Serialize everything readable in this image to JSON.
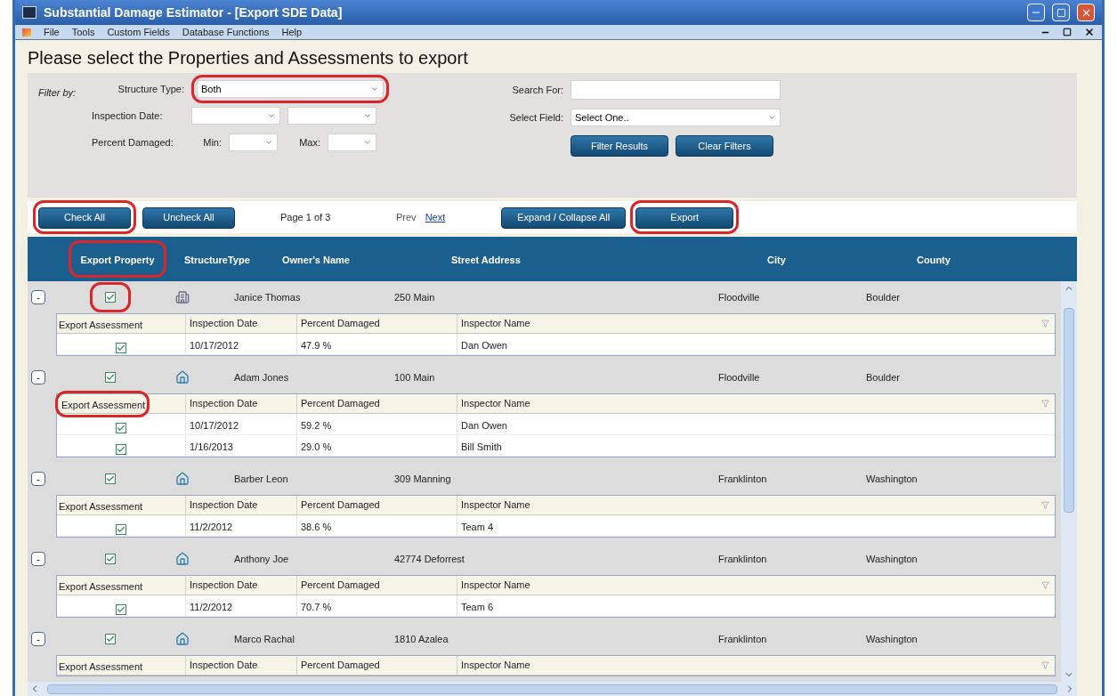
{
  "window": {
    "title": "Substantial Damage Estimator - [Export SDE Data]"
  },
  "menu": [
    "File",
    "Tools",
    "Custom Fields",
    "Database Functions",
    "Help"
  ],
  "heading": "Please select the Properties and Assessments to export",
  "filters": {
    "label": "Filter by:",
    "structure_type": {
      "label": "Structure Type:",
      "value": "Both",
      "highlighted": true
    },
    "inspection_date": {
      "label": "Inspection Date:"
    },
    "percent_damaged": {
      "label": "Percent Damaged:",
      "min_label": "Min:",
      "max_label": "Max:"
    },
    "search": {
      "label": "Search For:"
    },
    "select_field": {
      "label": "Select Field:",
      "value": "Select One.."
    },
    "buttons": [
      {
        "label": "Filter Results"
      },
      {
        "label": "Clear Filters"
      }
    ]
  },
  "toolbar": {
    "buttons": [
      {
        "label": "Check All",
        "highlighted": true
      },
      {
        "label": "Uncheck All",
        "highlighted": false
      }
    ],
    "page": "Page 1 of 3",
    "pager": [
      {
        "label": "Prev",
        "kind": "plain"
      },
      {
        "label": "Next",
        "kind": "link"
      }
    ],
    "actions": [
      {
        "label": "Expand / Collapse All",
        "highlighted": false
      },
      {
        "label": "Export",
        "highlighted": true
      }
    ]
  },
  "table": {
    "columns": [
      {
        "label": "Export Property",
        "highlighted": true
      },
      {
        "label": "StructureType",
        "highlighted": false
      },
      {
        "label": "Owner's Name",
        "highlighted": false
      },
      {
        "label": "Street Address",
        "highlighted": false
      },
      {
        "label": "City",
        "highlighted": false
      },
      {
        "label": "County",
        "highlighted": false
      }
    ],
    "properties": [
      {
        "toggle": "-",
        "checked": true,
        "highlighted": true,
        "kind": "building",
        "owner": "Janice Thomas",
        "address": "250 Main",
        "city": "Floodville",
        "county": "Boulder",
        "assessment_columns": [
          "Export Assessment",
          "Inspection Date",
          "Percent Damaged",
          "Inspector Name"
        ],
        "assessment_highlighted": false,
        "assessments": [
          {
            "checked": true,
            "date": "10/17/2012",
            "percent": "47.9 %",
            "inspector": "Dan Owen"
          }
        ]
      },
      {
        "toggle": "-",
        "checked": true,
        "highlighted": false,
        "kind": "house",
        "owner": "Adam Jones",
        "address": "100 Main",
        "city": "Floodville",
        "county": "Boulder",
        "assessment_columns": [
          "Export Assessment",
          "Inspection Date",
          "Percent Damaged",
          "Inspector Name"
        ],
        "assessment_highlighted": true,
        "assessments": [
          {
            "checked": true,
            "date": "10/17/2012",
            "percent": "59.2 %",
            "inspector": "Dan Owen"
          },
          {
            "checked": true,
            "date": "1/16/2013",
            "percent": "29.0 %",
            "inspector": "Bill Smith"
          }
        ]
      },
      {
        "toggle": "-",
        "checked": true,
        "highlighted": false,
        "kind": "house",
        "owner": "Barber Leon",
        "address": "309 Manning",
        "city": "Franklinton",
        "county": "Washington",
        "assessment_columns": [
          "Export Assessment",
          "Inspection Date",
          "Percent Damaged",
          "Inspector Name"
        ],
        "assessment_highlighted": false,
        "assessments": [
          {
            "checked": true,
            "date": "11/2/2012",
            "percent": "38.6 %",
            "inspector": "Team 4"
          }
        ]
      },
      {
        "toggle": "-",
        "checked": true,
        "highlighted": false,
        "kind": "house",
        "owner": "Anthony Joe",
        "address": "42774 Deforrest",
        "city": "Franklinton",
        "county": "Washington",
        "assessment_columns": [
          "Export Assessment",
          "Inspection Date",
          "Percent Damaged",
          "Inspector Name"
        ],
        "assessment_highlighted": false,
        "assessments": [
          {
            "checked": true,
            "date": "11/2/2012",
            "percent": "70.7 %",
            "inspector": "Team 6"
          }
        ]
      },
      {
        "toggle": "-",
        "checked": true,
        "highlighted": false,
        "kind": "house",
        "owner": "Marco Rachal",
        "address": "1810 Azalea",
        "city": "Franklinton",
        "county": "Washington",
        "assessment_columns": [
          "Export Assessment",
          "Inspection Date",
          "Percent Damaged",
          "Inspector Name"
        ],
        "assessment_highlighted": false
      }
    ]
  }
}
